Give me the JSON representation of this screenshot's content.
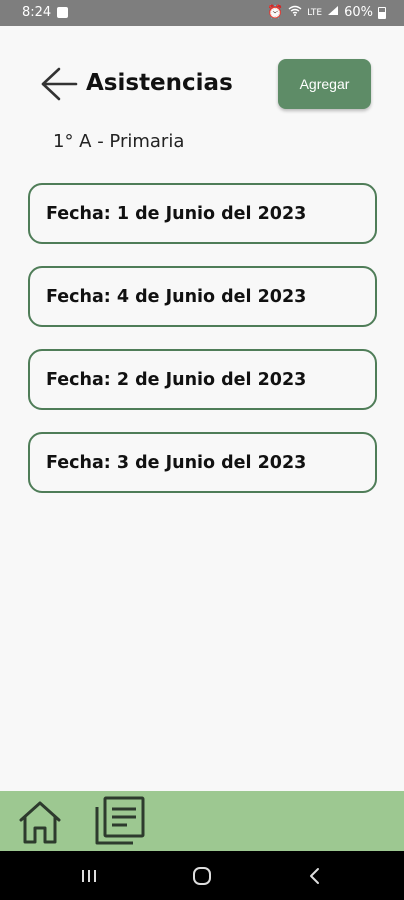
{
  "status_bar": {
    "time": "8:24",
    "network_label": "LTE",
    "battery": "60%"
  },
  "header": {
    "title": "Asistencias",
    "add_label": "Agregar",
    "accent_color": "#5e8c67"
  },
  "group": {
    "label": "1° A - Primaria"
  },
  "attendance": {
    "items": [
      {
        "label": "Fecha: 1 de Junio del 2023"
      },
      {
        "label": "Fecha: 4 de Junio del 2023"
      },
      {
        "label": "Fecha: 2 de Junio del 2023"
      },
      {
        "label": "Fecha: 3 de Junio del 2023"
      }
    ]
  },
  "bottom_nav": {
    "background": "#9dc891",
    "items": [
      {
        "icon": "home-icon"
      },
      {
        "icon": "documents-icon"
      }
    ]
  },
  "system_nav": {
    "items": [
      {
        "icon": "recent-apps-icon"
      },
      {
        "icon": "home-circle-icon"
      },
      {
        "icon": "back-chevron-icon"
      }
    ]
  }
}
